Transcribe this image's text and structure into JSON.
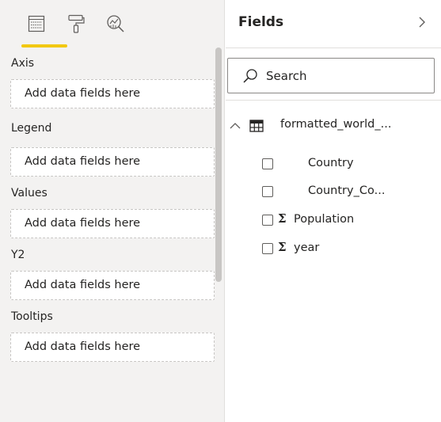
{
  "visualizations": {
    "tabs": [
      {
        "name": "fields-tab",
        "icon": "fields-icon",
        "active": true
      },
      {
        "name": "format-tab",
        "icon": "paint-roller-icon",
        "active": false
      },
      {
        "name": "analytics-tab",
        "icon": "analytics-magnifier-icon",
        "active": false
      }
    ],
    "accent_color": "#f2c811",
    "wells": [
      {
        "label": "Axis",
        "placeholder": "Add data fields here"
      },
      {
        "label": "Legend",
        "placeholder": "Add data fields here"
      },
      {
        "label": "Values",
        "placeholder": "Add data fields here"
      },
      {
        "label": "Y2",
        "placeholder": "Add data fields here"
      },
      {
        "label": "Tooltips",
        "placeholder": "Add data fields here"
      }
    ]
  },
  "fields_pane": {
    "title": "Fields",
    "collapse_icon": "chevron-right-icon",
    "search": {
      "placeholder": "Search",
      "value": ""
    },
    "table": {
      "name": "formatted_world_...",
      "expanded": true,
      "fields": [
        {
          "name": "Country",
          "aggregated": false,
          "checked": false
        },
        {
          "name": "Country_Co...",
          "aggregated": false,
          "checked": false
        },
        {
          "name": "Population",
          "aggregated": true,
          "checked": false
        },
        {
          "name": "year",
          "aggregated": true,
          "checked": false
        }
      ],
      "sigma": "Σ"
    }
  }
}
